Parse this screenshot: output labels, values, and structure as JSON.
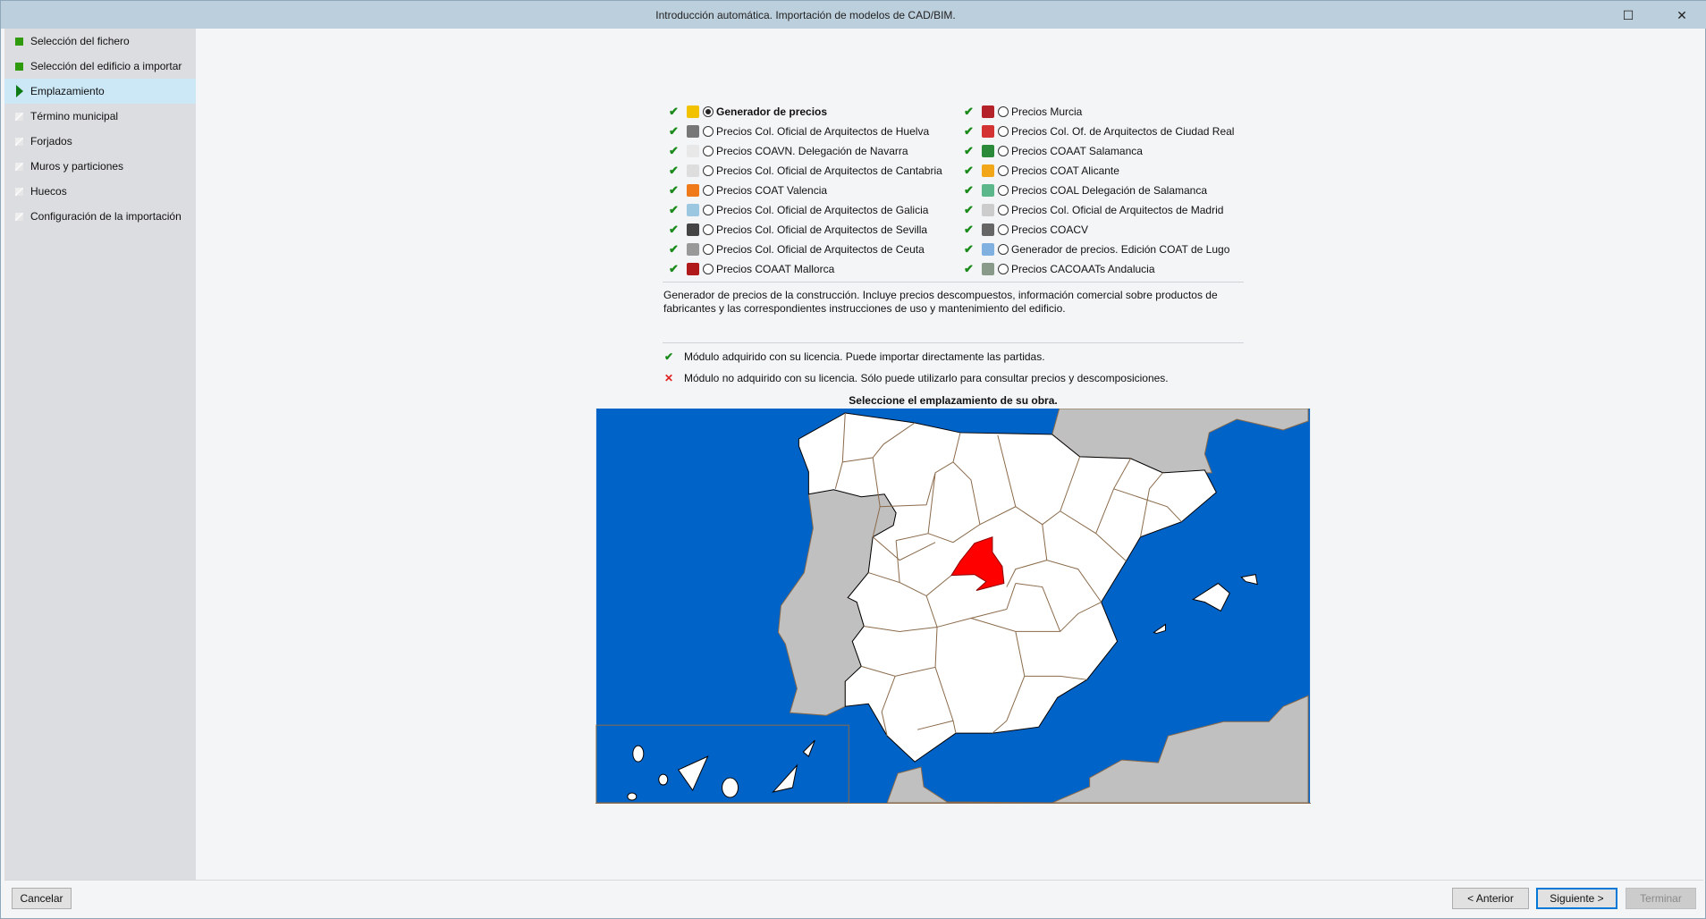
{
  "window": {
    "title": "Introducción automática. Importación de modelos de CAD/BIM.",
    "maximize": "☐",
    "close": "✕"
  },
  "sidebar": {
    "items": [
      {
        "label": "Selección del fichero",
        "state": "done"
      },
      {
        "label": "Selección del edificio a importar",
        "state": "done"
      },
      {
        "label": "Emplazamiento",
        "state": "active"
      },
      {
        "label": "Término municipal",
        "state": "todo"
      },
      {
        "label": "Forjados",
        "state": "todo"
      },
      {
        "label": "Muros y particiones",
        "state": "todo"
      },
      {
        "label": "Huecos",
        "state": "todo"
      },
      {
        "label": "Configuración de la importación",
        "state": "todo"
      }
    ]
  },
  "check_mark": "✔",
  "cross_mark": "✕",
  "options": {
    "left": [
      {
        "label": "Generador de precios",
        "selected": true,
        "color": "#f2c200"
      },
      {
        "label": "Precios Col. Oficial de Arquitectos de Huelva",
        "color": "#777777"
      },
      {
        "label": "Precios COAVN. Delegación de Navarra",
        "color": "#e8e8e8"
      },
      {
        "label": "Precios Col. Oficial de Arquitectos de Cantabria",
        "color": "#dddddd"
      },
      {
        "label": "Precios COAT Valencia",
        "color": "#f07a1a"
      },
      {
        "label": "Precios Col. Oficial de Arquitectos de Galicia",
        "color": "#9cc7e0"
      },
      {
        "label": "Precios Col. Oficial de Arquitectos de Sevilla",
        "color": "#444444"
      },
      {
        "label": "Precios Col. Oficial de Arquitectos de Ceuta",
        "color": "#999999"
      },
      {
        "label": "Precios COAAT Mallorca",
        "color": "#b01a1a"
      }
    ],
    "right": [
      {
        "label": "Precios Murcia",
        "color": "#b5232a"
      },
      {
        "label": "Precios Col. Of. de Arquitectos de Ciudad Real",
        "color": "#d33333"
      },
      {
        "label": "Precios COAAT Salamanca",
        "color": "#2a8a3a"
      },
      {
        "label": "Precios COAT Alicante",
        "color": "#f2a61a"
      },
      {
        "label": "Precios COAL Delegación de Salamanca",
        "color": "#5cb88a"
      },
      {
        "label": "Precios Col. Oficial de Arquitectos de Madrid",
        "color": "#cccccc"
      },
      {
        "label": "Precios COACV",
        "color": "#666666"
      },
      {
        "label": "Generador de precios. Edición COAT de Lugo",
        "color": "#7fb0e0"
      },
      {
        "label": "Precios CACOAATs Andalucia",
        "color": "#8a9a8a"
      }
    ]
  },
  "description": "Generador de precios de la construcción. Incluye precios descompuestos, información comercial sobre productos de fabricantes y las correspondientes instrucciones de uso y mantenimiento del edificio.",
  "legend": {
    "acquired": "Módulo adquirido con su licencia. Puede importar directamente las partidas.",
    "not_acquired": "Módulo no adquirido con su licencia. Sólo puede utilizarlo para consultar precios y descomposiciones."
  },
  "map": {
    "title": "Seleccione el emplazamiento de su obra.",
    "selected_region": "Madrid",
    "colors": {
      "sea": "#0063c8",
      "land": "#ffffff",
      "foreign": "#c0c0c0",
      "selected": "#ff0000",
      "border": "#8a6a4a"
    }
  },
  "footer": {
    "cancel": "Cancelar",
    "previous": "< Anterior",
    "next": "Siguiente >",
    "finish": "Terminar"
  }
}
